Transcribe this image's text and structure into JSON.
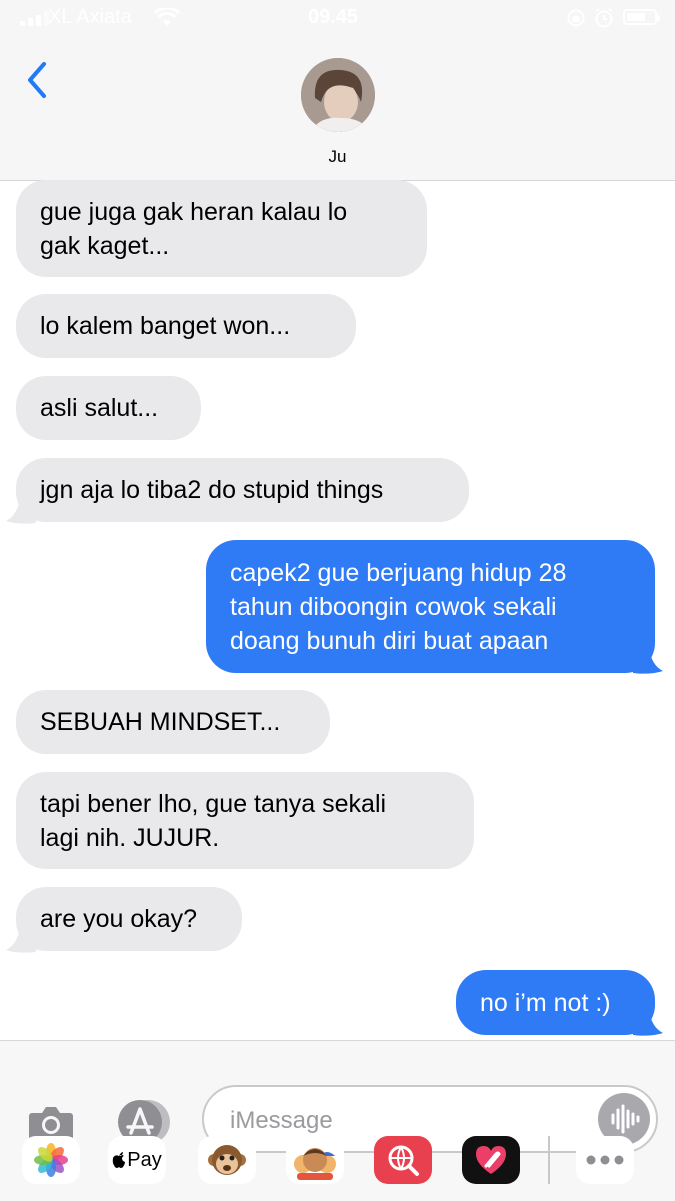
{
  "status_bar": {
    "carrier": "XL Axiata",
    "time": "09.45"
  },
  "header": {
    "back_icon": "chevron-left-icon",
    "contact_name": "Ju"
  },
  "messages": [
    {
      "direction": "incoming",
      "lines": [
        "gue juga gak heran kalau lo",
        "gak kaget..."
      ]
    },
    {
      "direction": "incoming",
      "lines": [
        "lo kalem banget won..."
      ]
    },
    {
      "direction": "incoming",
      "lines": [
        "asli salut..."
      ]
    },
    {
      "direction": "incoming",
      "lines": [
        "jgn aja lo tiba2 do stupid things"
      ]
    },
    {
      "direction": "outgoing",
      "lines": [
        "capek2 gue berjuang hidup 28",
        "tahun diboongin cowok sekali",
        "doang bunuh diri buat apaan"
      ]
    },
    {
      "direction": "incoming",
      "lines": [
        "SEBUAH MINDSET..."
      ]
    },
    {
      "direction": "incoming",
      "lines": [
        "tapi bener lho, gue tanya sekali",
        "lagi nih. JUJUR."
      ]
    },
    {
      "direction": "incoming",
      "lines": [
        "are you okay?"
      ]
    },
    {
      "direction": "outgoing",
      "lines": [
        "no i’m not :)"
      ]
    }
  ],
  "input": {
    "placeholder": "iMessage"
  },
  "app_drawer": {
    "apple_pay_label": "Pay"
  },
  "colors": {
    "outgoing_bubble": "#2f7bf5",
    "incoming_bubble": "#e9e9eb",
    "accent": "#1f7cf6"
  }
}
